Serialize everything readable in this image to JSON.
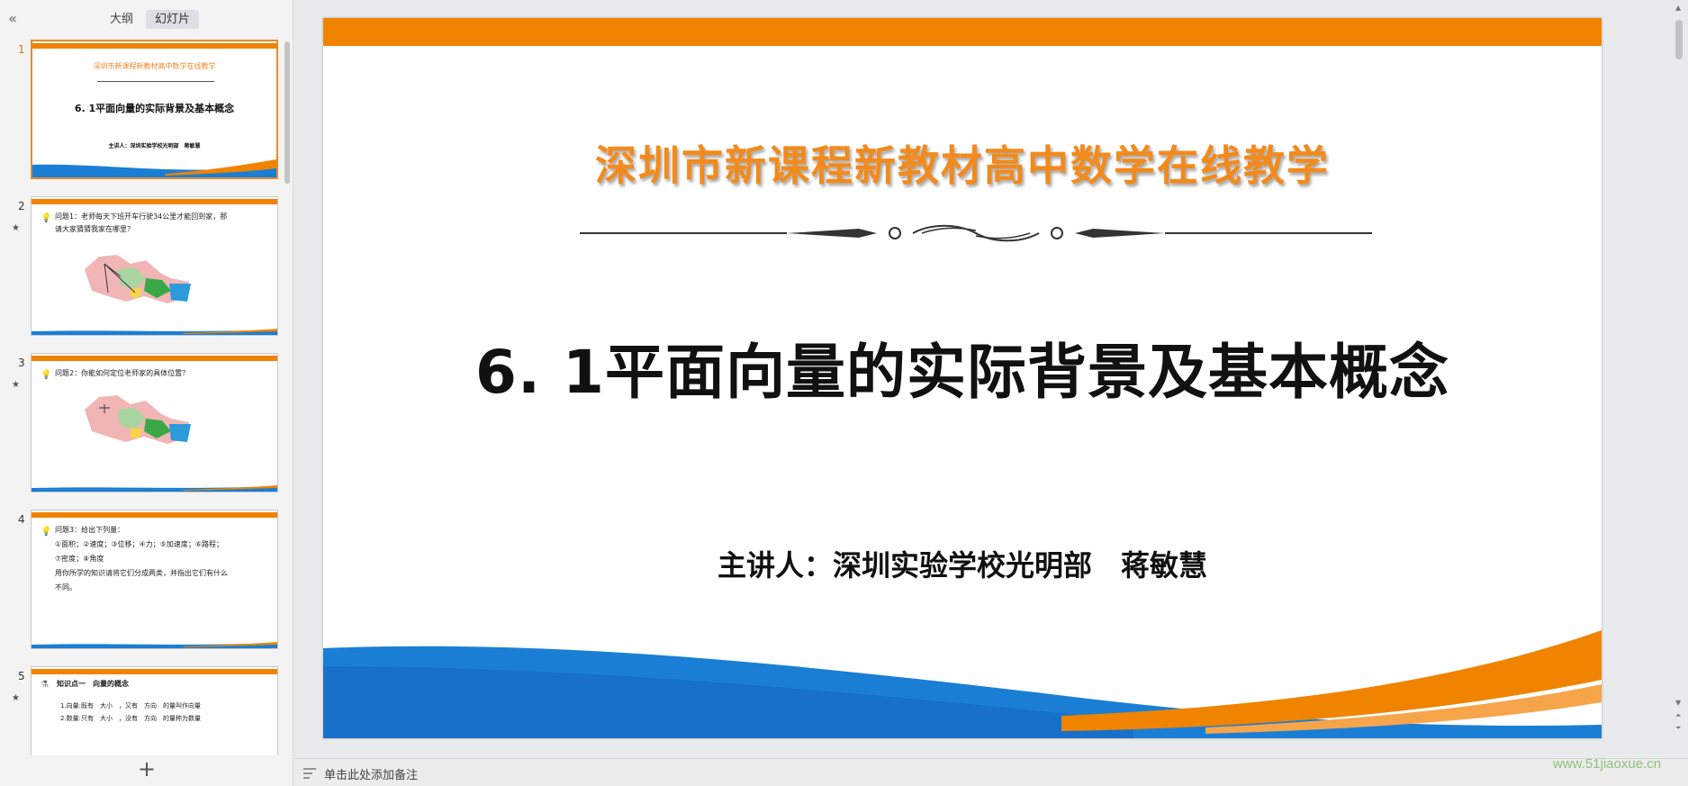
{
  "panel": {
    "collapse_icon": "«",
    "tabs": [
      {
        "label": "大纲",
        "active": false
      },
      {
        "label": "幻灯片",
        "active": true
      }
    ],
    "add_icon": "+"
  },
  "thumbnails": [
    {
      "num": "1",
      "star": "",
      "title_small": "深圳市新课程新教材高中数学在线教学",
      "title": "6. 1平面向量的实际背景及基本概念",
      "presenter": "主讲人：深圳实验学校光明部　蒋敏慧"
    },
    {
      "num": "2",
      "star": "★",
      "line1": "问题1：老师每天下班开车行驶34公里才能回到家，那",
      "line2": "请大家猜猜我家在哪里？"
    },
    {
      "num": "3",
      "star": "★",
      "line1": "问题2：你能如何定位老师家的具体位置？"
    },
    {
      "num": "4",
      "star": "",
      "line1": "问题3：给出下列量：",
      "line2": "①面积；②速度；③位移；④力；⑤加速度；⑥路程；",
      "line3": "⑦密度；⑧角度",
      "line4": "用你所学的知识请将它们分成两类，并指出它们有什么",
      "line5": "不同。"
    },
    {
      "num": "5",
      "star": "★",
      "line1": "知识点一　向量的概念",
      "line2": "1.向量:既有　大小　，又有　方向　的量叫作向量",
      "line3": "2.数量:只有　大小　，没有　方向　的量称为数量"
    }
  ],
  "slide": {
    "org_title": "深圳市新课程新教材高中数学在线教学",
    "main_title": "6. 1平面向量的实际背景及基本概念",
    "presenter": "主讲人：深圳实验学校光明部　蒋敏慧"
  },
  "notes": {
    "placeholder": "单击此处添加备注"
  },
  "watermark": "www.51jiaoxue.cn",
  "colors": {
    "accent_orange": "#f08300",
    "wave_blue": "#1a7fd4",
    "title_orange": "#f28a1c"
  }
}
